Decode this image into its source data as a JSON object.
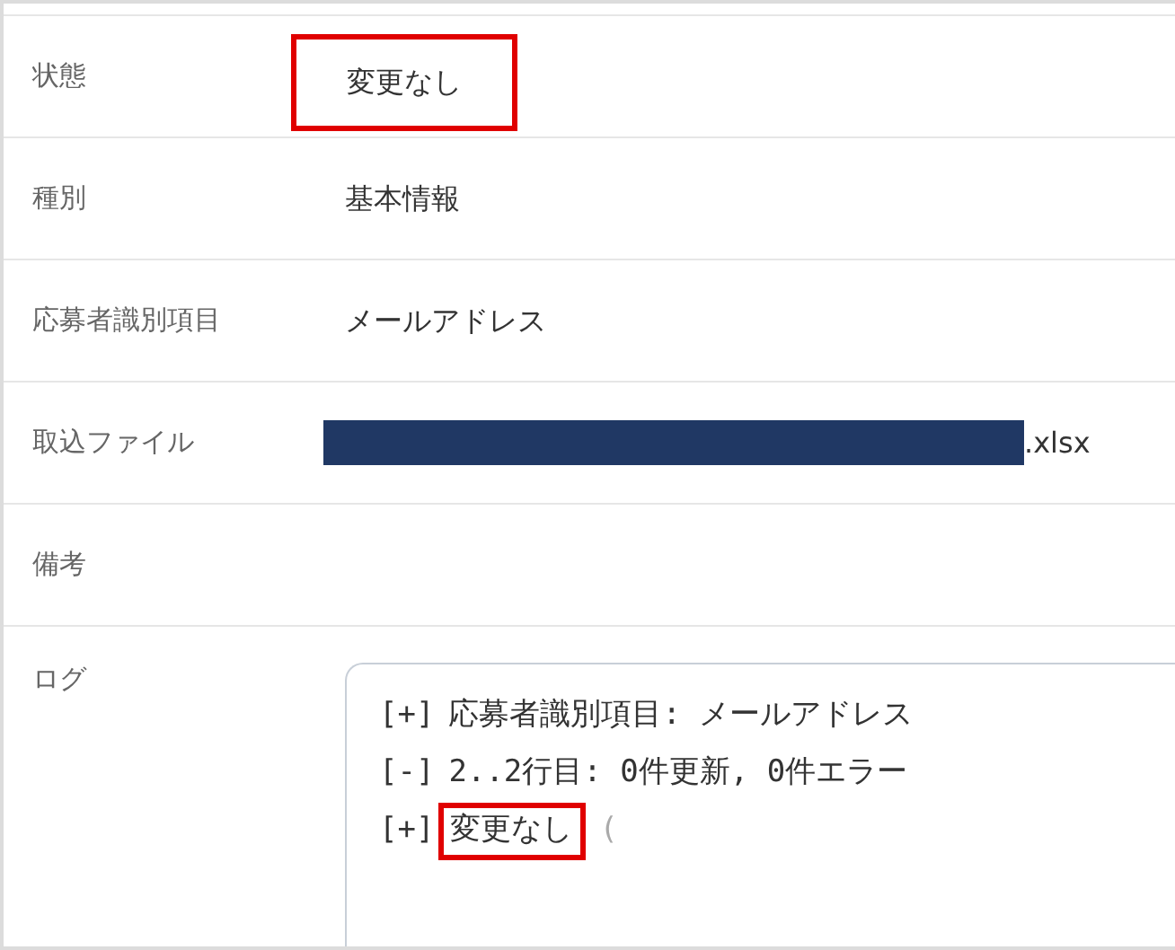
{
  "fields": [
    {
      "label": "状態",
      "value": "変更なし",
      "highlighted": true
    },
    {
      "label": "種別",
      "value": "基本情報"
    },
    {
      "label": "応募者識別項目",
      "value": "メールアドレス"
    },
    {
      "label": "取込ファイル",
      "value": ".xlsx",
      "redacted": true
    },
    {
      "label": "備考"
    }
  ],
  "log": {
    "label": "ログ",
    "lines": [
      {
        "prefix": "[+]",
        "text": "応募者識別項目: メールアドレス",
        "highlighted": false
      },
      {
        "prefix": "[-]",
        "text": "2..2行目: 0件更新, 0件エラー",
        "highlighted": false
      },
      {
        "prefix": "[+]",
        "text": "変更なし",
        "highlighted": true,
        "suffix": "("
      }
    ]
  }
}
